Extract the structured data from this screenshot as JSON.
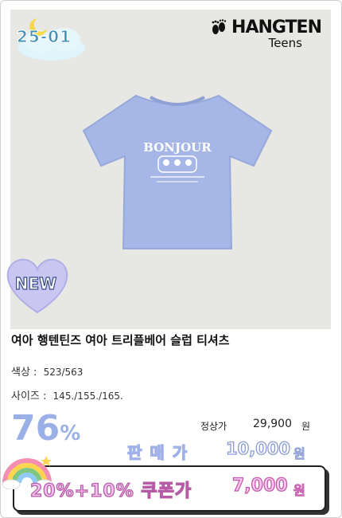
{
  "season": {
    "code": "25-01",
    "icon": "moon-cloud-icon"
  },
  "brand": {
    "name": "HANGTEN",
    "sub": "Teens",
    "icon": "footprints-icon"
  },
  "product_image": {
    "print_text": "BONJOUR",
    "badge": "NEW",
    "color": "#a6b6e6"
  },
  "product": {
    "title": "여아 행텐틴즈 여아 트리플베어 슬럽 티셔츠",
    "color_label": "색상 :",
    "color_value": "523/563",
    "size_label": "사이즈 :",
    "size_value": "145./155./165."
  },
  "pricing": {
    "discount_value": "76",
    "discount_unit": "%",
    "regular_label": "정상가",
    "regular_price": "29,900",
    "regular_unit": "원",
    "sale_label": "판매가",
    "sale_price": "10,000",
    "sale_unit": "원",
    "coupon_label": "20%+10% 쿠폰가",
    "coupon_price": "7,000",
    "coupon_unit": "원"
  },
  "colors": {
    "accent_blue": "#9bb0e6",
    "accent_pink": "#f6c3ee"
  }
}
